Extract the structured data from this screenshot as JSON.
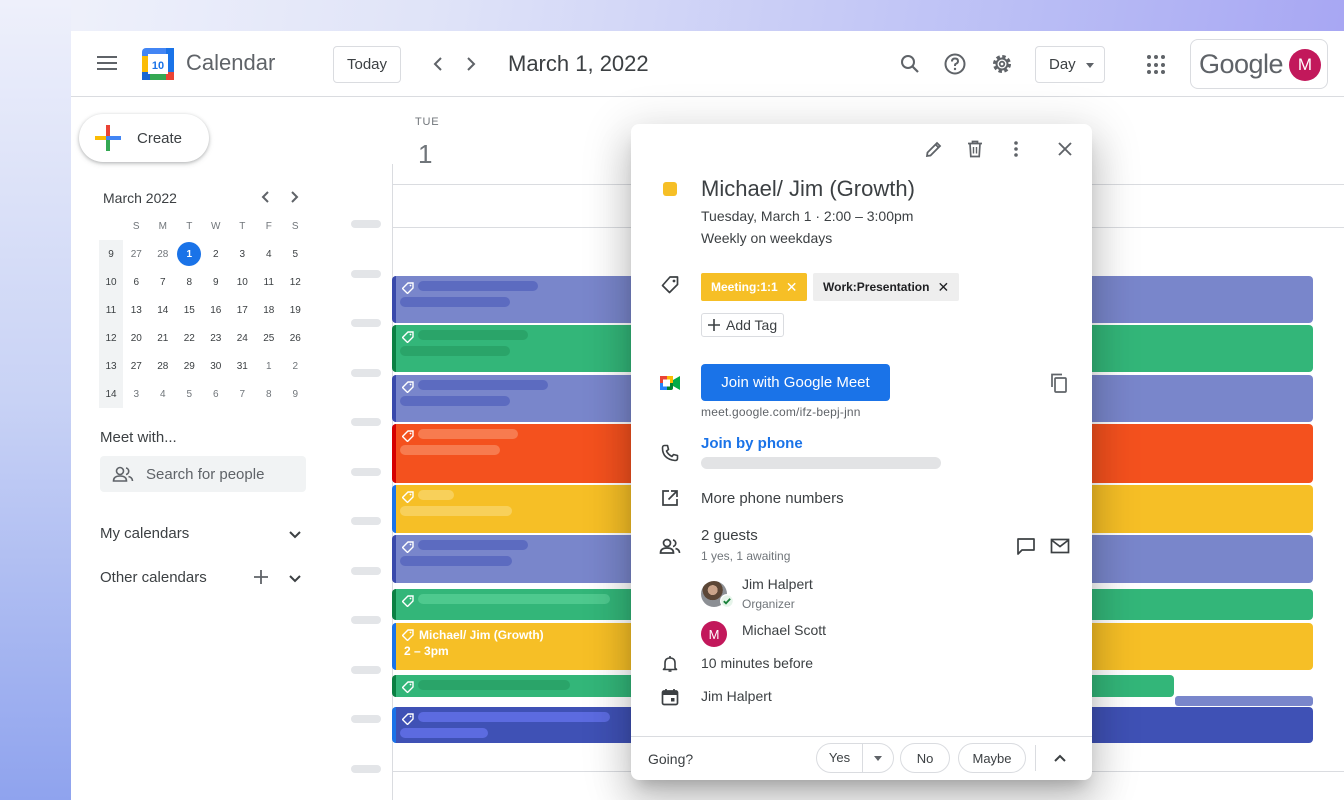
{
  "header": {
    "app_title": "Calendar",
    "logo_day": "10",
    "today_label": "Today",
    "date_title": "March 1, 2022",
    "view_label": "Day",
    "google_label": "Google",
    "avatar_initial": "M"
  },
  "sidebar": {
    "create_label": "Create",
    "mini_month": "March 2022",
    "weekday_heads": [
      "S",
      "M",
      "T",
      "W",
      "T",
      "F",
      "S"
    ],
    "weeks": [
      {
        "wk": "9",
        "days": [
          "27",
          "28",
          "1",
          "2",
          "3",
          "4",
          "5"
        ]
      },
      {
        "wk": "10",
        "days": [
          "6",
          "7",
          "8",
          "9",
          "10",
          "11",
          "12"
        ]
      },
      {
        "wk": "11",
        "days": [
          "13",
          "14",
          "15",
          "16",
          "17",
          "18",
          "19"
        ]
      },
      {
        "wk": "12",
        "days": [
          "20",
          "21",
          "22",
          "23",
          "24",
          "25",
          "26"
        ]
      },
      {
        "wk": "13",
        "days": [
          "27",
          "28",
          "29",
          "30",
          "31",
          "1",
          "2"
        ]
      },
      {
        "wk": "14",
        "days": [
          "3",
          "4",
          "5",
          "6",
          "7",
          "8",
          "9"
        ]
      }
    ],
    "meet_with": "Meet with...",
    "search_people_placeholder": "Search for people",
    "my_calendars": "My calendars",
    "other_calendars": "Other calendars"
  },
  "day_view": {
    "weekday": "TUE",
    "day_number": "1",
    "highlighted_event_title": "Michael/ Jim (Growth)",
    "highlighted_event_time": "2 – 3pm"
  },
  "event_popup": {
    "title": "Michael/ Jim (Growth)",
    "date_line": "Tuesday, March 1  ·  2:00 – 3:00pm",
    "recurrence": "Weekly on weekdays",
    "tags": [
      "Meeting:1:1",
      "Work:Presentation"
    ],
    "add_tag_label": "Add Tag",
    "meet_button": "Join with Google Meet",
    "meet_url": "meet.google.com/ifz-bepj-jnn",
    "join_by_phone": "Join by phone",
    "more_phone_numbers": "More phone numbers",
    "guests_count": "2 guests",
    "guests_status": "1 yes, 1 awaiting",
    "guests": [
      {
        "name": "Jim Halpert",
        "role": "Organizer"
      },
      {
        "name": "Michael Scott",
        "role": "",
        "initial": "M"
      }
    ],
    "reminder": "10 minutes before",
    "calendar_owner": "Jim Halpert",
    "going_label": "Going?",
    "rsvp": {
      "yes": "Yes",
      "no": "No",
      "maybe": "Maybe"
    }
  },
  "colors": {
    "accent_blue": "#1a73e8",
    "event_lavender": "#7986cb",
    "event_green": "#33b679",
    "event_tangerine": "#f4511e",
    "event_banana": "#f6bf26",
    "event_blueberry": "#3f51b5",
    "avatar_magenta": "#c2185b"
  }
}
